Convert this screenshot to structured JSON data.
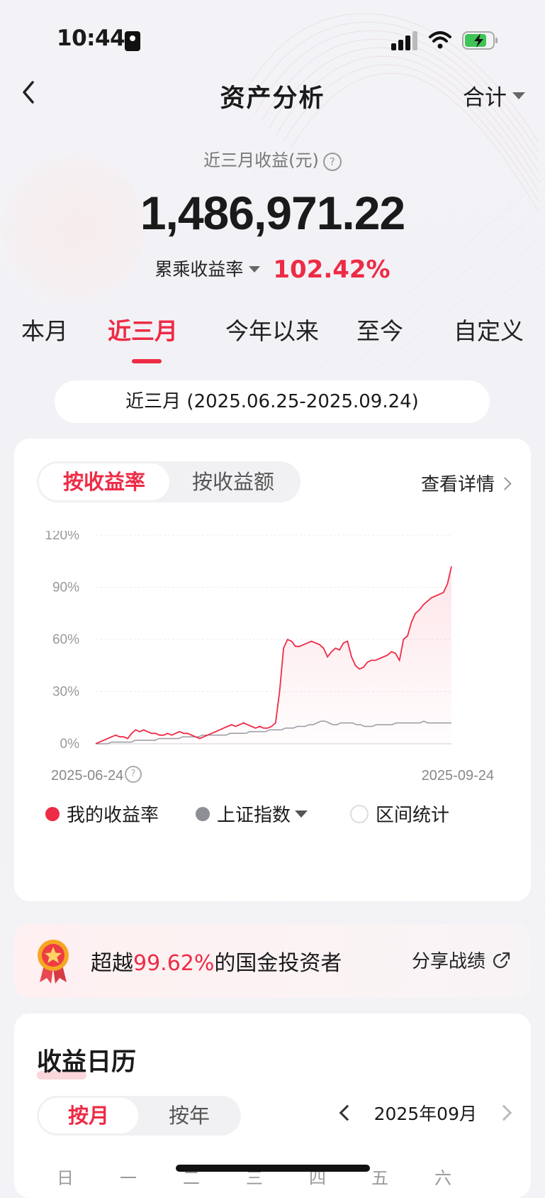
{
  "status": {
    "time": "10:44"
  },
  "nav": {
    "title": "资产分析",
    "scope": "合计"
  },
  "summary": {
    "label": "近三月收益(元)",
    "value": "1,486,971.22",
    "rate_label": "累乘收益率",
    "rate_value": "102.42%"
  },
  "periods": [
    "本月",
    "近三月",
    "今年以来",
    "至今",
    "自定义"
  ],
  "range_text": "近三月 (2025.06.25-2025.09.24)",
  "chart_card": {
    "tabs": [
      "按收益率",
      "按收益额"
    ],
    "detail": "查看详情",
    "start_date": "2025-06-24",
    "end_date": "2025-09-24",
    "legend": [
      "我的收益率",
      "上证指数",
      "区间统计"
    ]
  },
  "chart_data": {
    "type": "line",
    "x_range": [
      "2025-06-24",
      "2025-09-24"
    ],
    "ylim": [
      0,
      120
    ],
    "yticks": [
      "120%",
      "90%",
      "60%",
      "30%",
      "0%"
    ],
    "grid": true,
    "series": [
      {
        "name": "我的收益率",
        "color": "#ee2b46",
        "values": [
          0,
          1,
          2,
          3,
          4,
          5,
          4,
          4,
          3,
          6,
          8,
          7,
          8,
          7,
          6,
          6,
          5,
          5,
          6,
          5,
          6,
          7,
          6,
          6,
          5,
          4,
          3,
          4,
          5,
          6,
          7,
          8,
          9,
          10,
          11,
          10,
          11,
          12,
          11,
          10,
          9,
          10,
          9,
          9,
          10,
          12,
          30,
          55,
          60,
          59,
          56,
          56,
          57,
          58,
          59,
          58,
          57,
          55,
          50,
          53,
          55,
          54,
          58,
          59,
          50,
          45,
          43,
          44,
          47,
          48,
          48,
          49,
          50,
          51,
          53,
          52,
          48,
          60,
          62,
          70,
          75,
          77,
          80,
          82,
          84,
          85,
          86,
          87,
          92,
          102
        ]
      },
      {
        "name": "上证指数",
        "color": "#9a9aa2",
        "values": [
          0,
          0,
          0,
          0,
          1,
          1,
          1,
          1,
          1,
          1,
          2,
          2,
          2,
          2,
          2,
          2,
          3,
          3,
          3,
          3,
          3,
          3,
          4,
          4,
          4,
          4,
          4,
          5,
          5,
          5,
          5,
          5,
          5,
          5,
          6,
          6,
          6,
          6,
          6,
          7,
          7,
          7,
          7,
          7,
          8,
          8,
          8,
          8,
          9,
          9,
          9,
          10,
          10,
          10,
          11,
          11,
          12,
          13,
          13,
          12,
          11,
          11,
          12,
          12,
          12,
          12,
          11,
          11,
          10,
          10,
          10,
          11,
          11,
          11,
          11,
          11,
          12,
          12,
          12,
          12,
          12,
          12,
          12,
          13,
          12,
          12,
          12,
          12,
          12,
          12,
          12
        ]
      }
    ]
  },
  "beat": {
    "prefix": "超越",
    "percent": "99.62%",
    "suffix": "的国金投资者",
    "share": "分享战绩"
  },
  "calendar": {
    "title": "收益日历",
    "tabs": [
      "按月",
      "按年"
    ],
    "month": "2025年09月",
    "weekdays": [
      "日",
      "一",
      "二",
      "三",
      "四",
      "五",
      "六"
    ]
  }
}
